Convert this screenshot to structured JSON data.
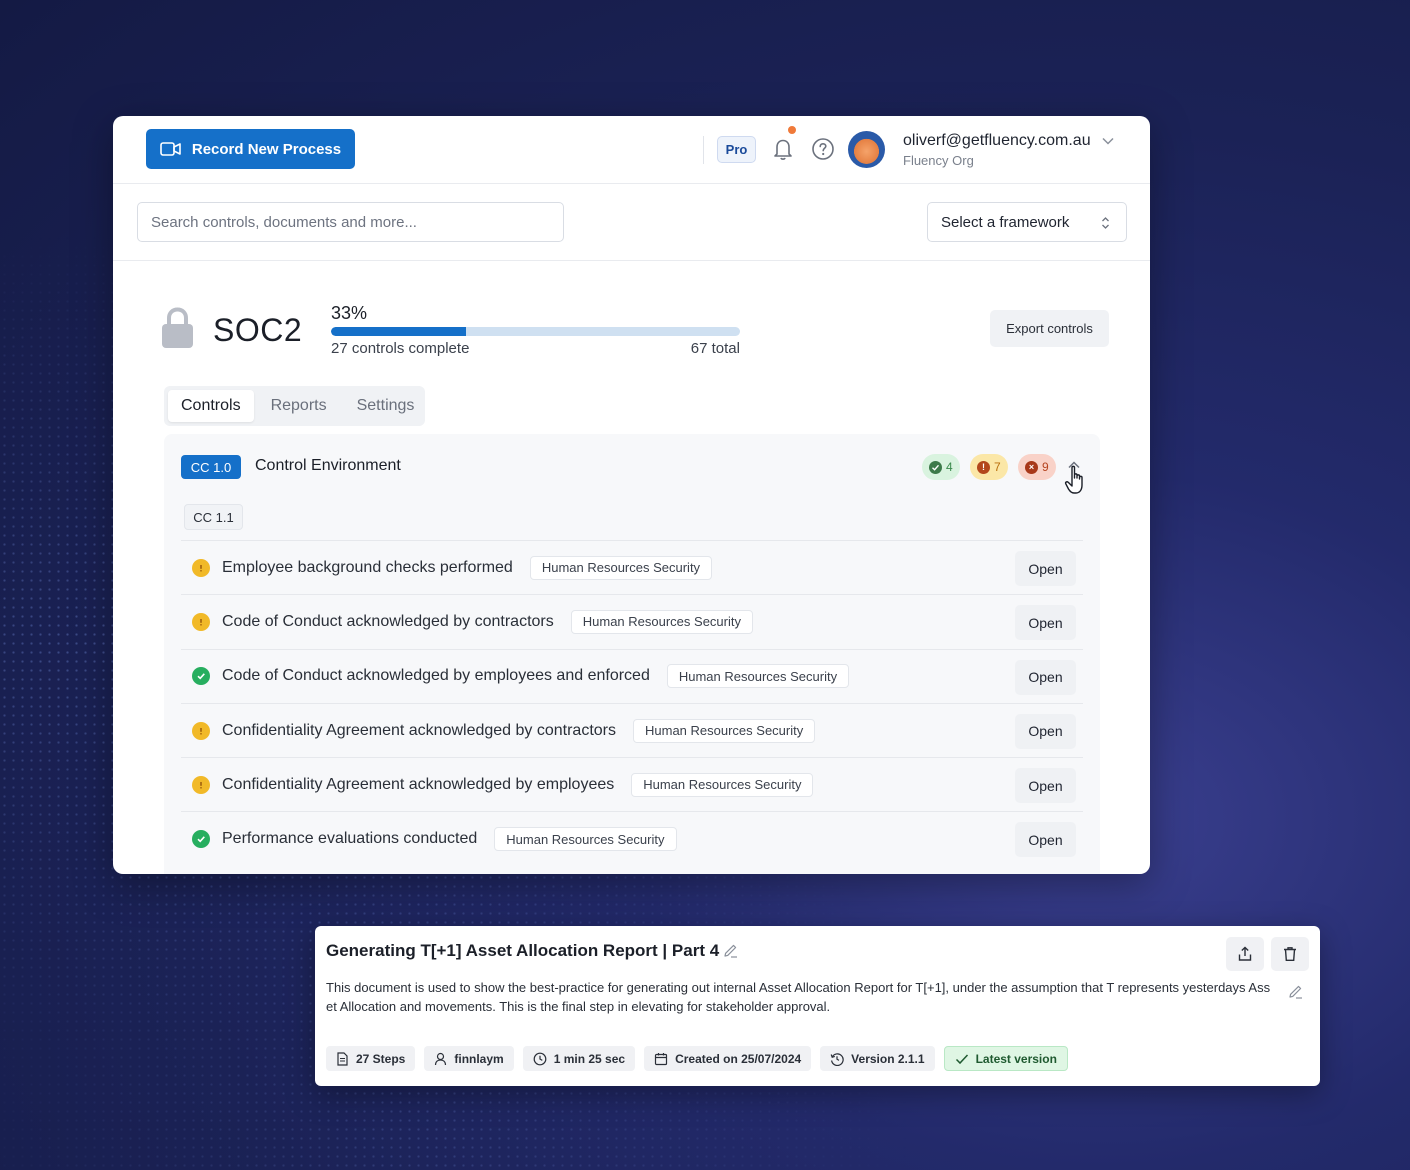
{
  "topbar": {
    "record_button": "Record New Process",
    "plan_badge": "Pro",
    "user_email": "oliverf@getfluency.com.au",
    "user_org": "Fluency Org",
    "notification_color": "#f07a3a"
  },
  "search": {
    "placeholder": "Search controls, documents and more...",
    "framework_select": "Select a framework"
  },
  "framework": {
    "name": "SOC2",
    "progress_percent_label": "33%",
    "progress_fraction": 0.33,
    "complete_label": "27 controls complete",
    "total_label": "67 total",
    "export_button": "Export controls"
  },
  "tabs": [
    "Controls",
    "Reports",
    "Settings"
  ],
  "active_tab": "Controls",
  "section": {
    "code": "CC 1.0",
    "title": "Control Environment",
    "counts": {
      "complete": "4",
      "warning": "7",
      "error": "9"
    },
    "subgroup": "CC 1.1",
    "open_label": "Open",
    "controls": [
      {
        "label": "Employee background checks performed",
        "tag": "Human Resources Security",
        "status": "warning"
      },
      {
        "label": "Code of Conduct acknowledged by contractors",
        "tag": "Human Resources Security",
        "status": "warning"
      },
      {
        "label": "Code of Conduct acknowledged by employees and enforced",
        "tag": "Human Resources Security",
        "status": "complete"
      },
      {
        "label": "Confidentiality Agreement acknowledged by contractors",
        "tag": "Human Resources Security",
        "status": "warning"
      },
      {
        "label": "Confidentiality Agreement acknowledged by employees",
        "tag": "Human Resources Security",
        "status": "warning"
      },
      {
        "label": "Performance evaluations conducted",
        "tag": "Human Resources Security",
        "status": "complete"
      }
    ]
  },
  "document": {
    "title": "Generating T[+1] Asset Allocation Report | Part 4",
    "description": "This document is used to show the best-practice for generating out internal Asset Allocation Report for T[+1], under the assumption that T represents yesterdays Asset Allocation and movements. This is the final step in elevating for stakeholder approval.",
    "meta": {
      "steps": "27 Steps",
      "author": "finnlaym",
      "duration": "1 min 25 sec",
      "created": "Created on 25/07/2024",
      "version": "Version 2.1.1",
      "latest": "Latest version"
    }
  },
  "colors": {
    "primary": "#1570c9",
    "warning": "#f1b928",
    "success": "#27ae5f",
    "error": "#a8381a"
  }
}
